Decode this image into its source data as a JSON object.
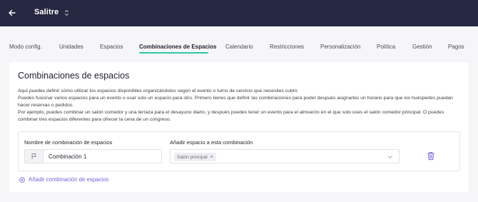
{
  "header": {
    "venue_name": "Salitre",
    "back_icon": "arrow-left-icon",
    "switch_icon": "chevron-up-down-icon",
    "background": "#262741"
  },
  "tabs": [
    {
      "label": "Modo config.",
      "active": false
    },
    {
      "label": "Unidades",
      "active": false
    },
    {
      "label": "Espacios",
      "active": false
    },
    {
      "label": "Combinaciones de Espacios",
      "active": true
    },
    {
      "label": "Calendario",
      "active": false
    },
    {
      "label": "Restricciones",
      "active": false
    },
    {
      "label": "Personalización",
      "active": false
    },
    {
      "label": "Política",
      "active": false
    },
    {
      "label": "Gestión",
      "active": false
    },
    {
      "label": "Pagos",
      "active": false
    }
  ],
  "accent_color": "#2fc7a7",
  "link_color": "#6f64d6",
  "section": {
    "title": "Combinaciones de espacios",
    "description": [
      "Aquí puedes definir cómo utilizar los espacios disponibles organizándolos según el evento o turno de servicio que necesites cubrir.",
      "Puedes fusionar varios espacios para un evento o usar solo un espacio para otro. Primero tienes que definir las combinaciones para poder después asignarles un horario para que los huéspedes puedan hacer reservas o pedidos.",
      "Por ejemplo, puedes combinar un salón comedor y una terraza para el desayuno diario, y después puedes tener un evento para el almuerzo en el que solo uses el salón comedor principal. O puedes combinar tres espacios diferentes para ofrecer la cena de un congreso."
    ]
  },
  "combination": {
    "name_label": "Nombre de combinación de espacios",
    "name_value": "Combinación 1",
    "name_icon": "flag-icon",
    "spaces_label": "Añadir espacio a esta combinación",
    "selected_spaces": [
      "Salón principal"
    ],
    "chip_remove_label": "×",
    "delete_icon": "trash-icon"
  },
  "add_link": {
    "label": "Añadir combinación de espacios",
    "icon": "plus-circle-icon"
  }
}
